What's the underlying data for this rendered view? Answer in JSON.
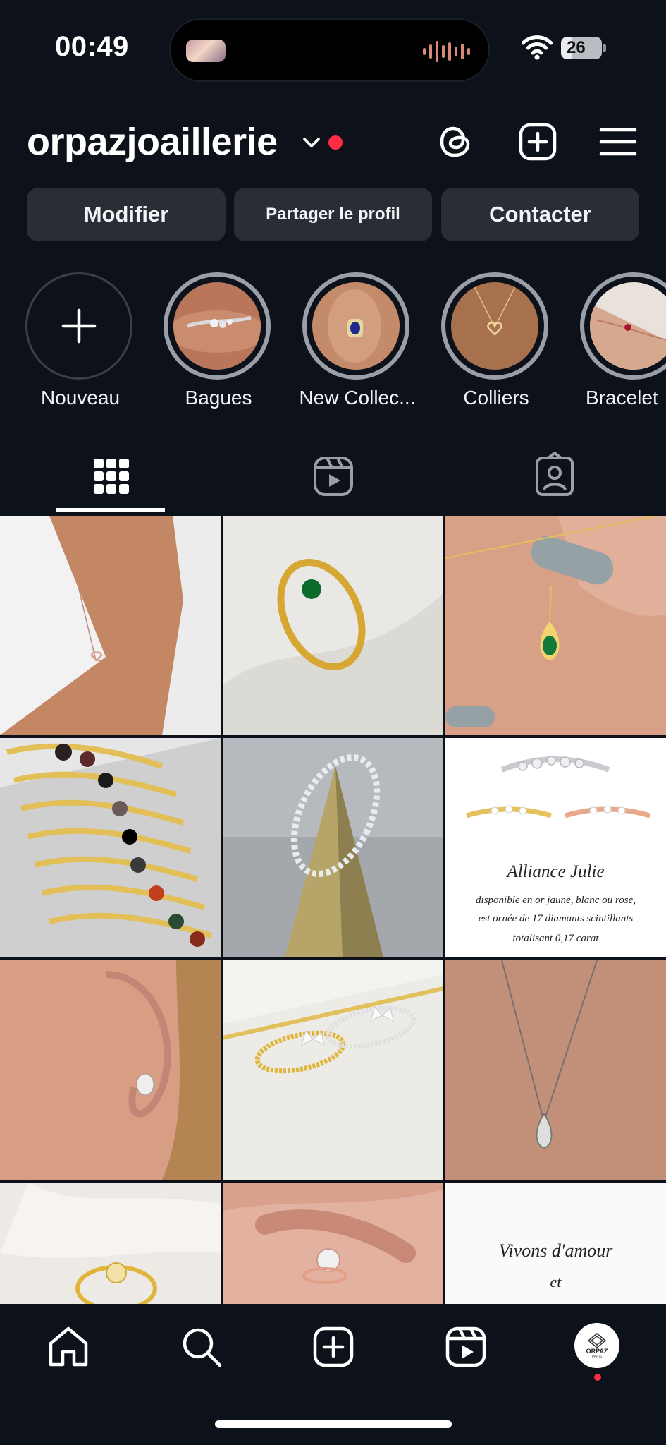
{
  "status_bar": {
    "time": "00:49",
    "battery": "26",
    "battery_level": 0.26
  },
  "header": {
    "username": "orpazjoaillerie"
  },
  "buttons": {
    "edit": "Modifier",
    "share": "Partager le profil",
    "contact": "Contacter"
  },
  "highlights": [
    {
      "label": "Nouveau"
    },
    {
      "label": "Bagues"
    },
    {
      "label": "New Collec..."
    },
    {
      "label": "Colliers"
    },
    {
      "label": "Bracelet"
    }
  ],
  "posts": [
    {
      "caption_title": "Alliance Julie",
      "caption_lines": [
        "disponible en or jaune, blanc ou rose,",
        "est ornée de 17 diamants scintillants",
        "totalisant 0,17 carat"
      ]
    },
    {
      "caption_lines": [
        "Vivons d'amour",
        "et"
      ]
    }
  ],
  "avatar": {
    "logo_text": "ORPAZ",
    "logo_sub": "PARIS"
  },
  "colors": {
    "background": "#0d121a",
    "button": "#282d36",
    "notification": "#ff2d43"
  }
}
